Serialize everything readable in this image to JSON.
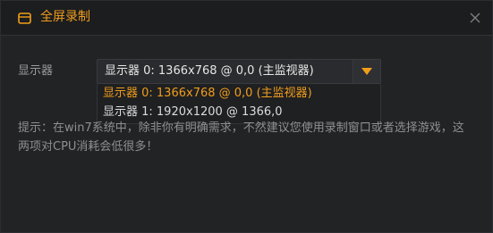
{
  "window": {
    "title": "全屏录制",
    "icon": "window-icon",
    "close_icon": "close-icon"
  },
  "display": {
    "label": "显示器",
    "selected": "显示器 0: 1366x768 @ 0,0 (主监视器)",
    "options": [
      "显示器 0: 1366x768 @ 0,0 (主监视器)",
      "显示器 1: 1920x1200 @ 1366,0"
    ],
    "highlighted_option_index": 0
  },
  "hint": {
    "text": "提示：在win7系统中，除非你有明确需求，不然建议您使用录制窗口或者选择游戏，这两项对CPU消耗会低很多！"
  },
  "colors": {
    "accent": "#f19d1b",
    "background": "#222325",
    "titlebar": "#1c1d1f",
    "text_muted": "#8e8f92"
  }
}
